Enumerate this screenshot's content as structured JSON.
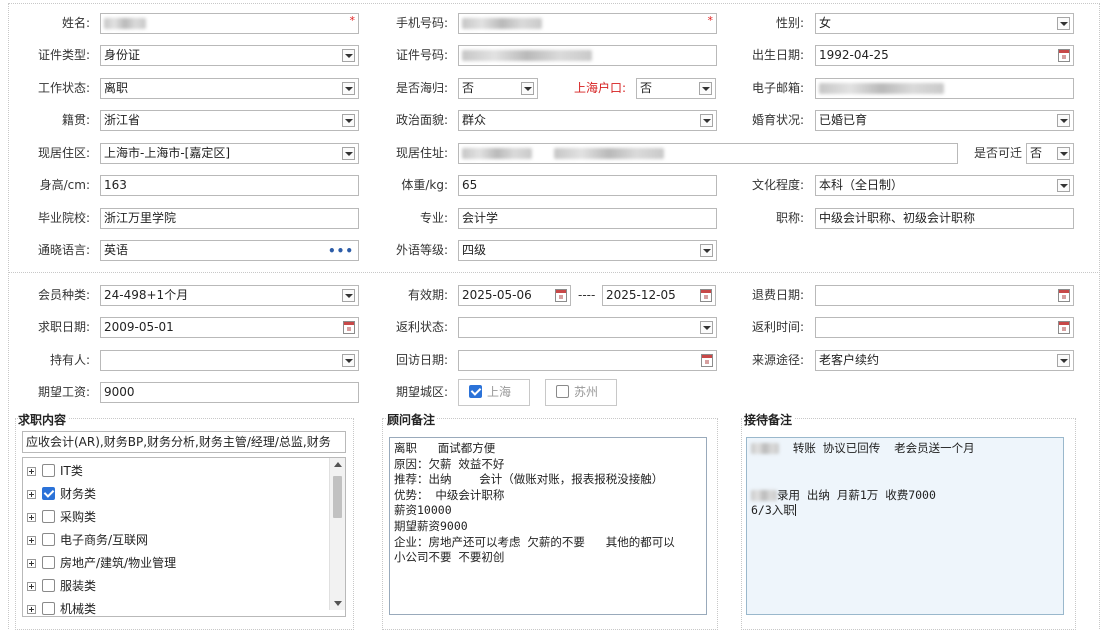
{
  "personal": {
    "name": {
      "label": "姓名:"
    },
    "phone": {
      "label": "手机号码:"
    },
    "gender": {
      "label": "性别:",
      "value": "女"
    },
    "id_type": {
      "label": "证件类型:",
      "value": "身份证"
    },
    "id_number": {
      "label": "证件号码:"
    },
    "birth_date": {
      "label": "出生日期:",
      "value": "1992-04-25"
    },
    "work_status": {
      "label": "工作状态:",
      "value": "离职"
    },
    "overseas_returnee": {
      "label": "是否海归:",
      "value": "否"
    },
    "shanghai_hukou": {
      "label": "上海户口:",
      "value": "否"
    },
    "email": {
      "label": "电子邮箱:"
    },
    "native_place": {
      "label": "籍贯:",
      "value": "浙江省"
    },
    "political_status": {
      "label": "政治面貌:",
      "value": "群众"
    },
    "marital_status": {
      "label": "婚育状况:",
      "value": "已婚已育"
    },
    "current_area": {
      "label": "现居住区:",
      "value": "上海市-上海市-[嘉定区]"
    },
    "current_address": {
      "label": "现居住址:"
    },
    "relocatable": {
      "label": "是否可迁",
      "value": "否"
    },
    "height": {
      "label": "身高/cm:",
      "value": "163"
    },
    "weight": {
      "label": "体重/kg:",
      "value": "65"
    },
    "education": {
      "label": "文化程度:",
      "value": "本科（全日制）"
    },
    "school": {
      "label": "毕业院校:",
      "value": "浙江万里学院"
    },
    "major": {
      "label": "专业:",
      "value": "会计学"
    },
    "title": {
      "label": "职称:",
      "value": "中级会计职称、初级会计职称"
    },
    "language": {
      "label": "通晓语言:",
      "value": "英语"
    },
    "foreign_level": {
      "label": "外语等级:",
      "value": "四级"
    }
  },
  "membership": {
    "member_type": {
      "label": "会员种类:",
      "value": "24-498+1个月"
    },
    "validity": {
      "label": "有效期:",
      "start": "2025-05-06",
      "separator": "----",
      "end": "2025-12-05"
    },
    "refund_date": {
      "label": "退费日期:"
    },
    "job_seek_date": {
      "label": "求职日期:",
      "value": "2009-05-01"
    },
    "rebate_status": {
      "label": "返利状态:"
    },
    "rebate_time": {
      "label": "返利时间:"
    },
    "holder": {
      "label": "持有人:"
    },
    "visit_date": {
      "label": "回访日期:"
    },
    "source": {
      "label": "来源途径:",
      "value": "老客户续约"
    },
    "expected_salary": {
      "label": "期望工资:",
      "value": "9000"
    },
    "expected_area": {
      "label": "期望城区:",
      "options": [
        {
          "label": "上海",
          "checked": true
        },
        {
          "label": "苏州",
          "checked": false
        }
      ]
    }
  },
  "job_content": {
    "title": "求职内容",
    "summary": "应收会计(AR),财务BP,财务分析,财务主管/经理/总监,财务",
    "tree": [
      {
        "label": "IT类",
        "checked": false
      },
      {
        "label": "财务类",
        "checked": true
      },
      {
        "label": "采购类",
        "checked": false
      },
      {
        "label": "电子商务/互联网",
        "checked": false
      },
      {
        "label": "房地产/建筑/物业管理",
        "checked": false
      },
      {
        "label": "服装类",
        "checked": false
      },
      {
        "label": "机械类",
        "checked": false
      }
    ]
  },
  "consultant_notes": {
    "title": "顾问备注",
    "text": "离职   面试都方便\n原因：欠薪 效益不好\n推荐：出纳    会计（做账对账，报表报税没接触）\n优势： 中级会计职称\n薪资10000\n期望薪资9000\n企业：房地产还可以考虑 欠薪的不要   其他的都可以     小公司不要 不要初创"
  },
  "reception_notes": {
    "title": "接待备注",
    "line1": "转账 协议已回传  老会员送一个月",
    "line2": "录用 出纳 月薪1万 收费7000",
    "line3": "6/3入职"
  },
  "colors": {
    "accent": "#2b72d8",
    "required": "#e02020",
    "label_red": "#d61f1f"
  }
}
